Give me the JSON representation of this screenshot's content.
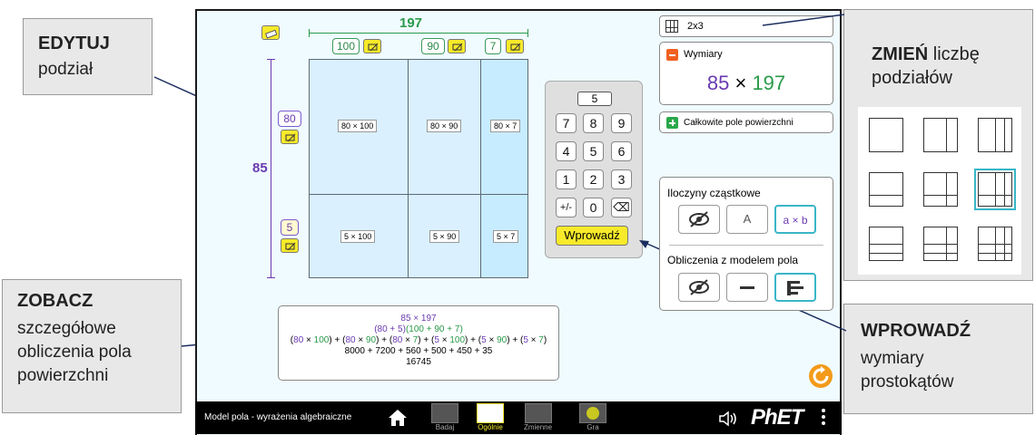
{
  "callouts": {
    "edit": {
      "bold": "EDYTUJ",
      "text": "podział"
    },
    "change": {
      "bold": "ZMIEŃ",
      "text1": "liczbę",
      "text2": "podziałów"
    },
    "view": {
      "bold": "ZOBACZ",
      "lines": [
        "szczegółowe",
        "obliczenia pola",
        "powierzchni"
      ]
    },
    "enter": {
      "bold": "WPROWADŹ",
      "lines": [
        "wymiary",
        "prostokątów"
      ]
    }
  },
  "top_dims": {
    "total": "197",
    "parts": [
      "100",
      "90",
      "7"
    ]
  },
  "left_dims": {
    "total": "85",
    "parts": [
      "80",
      "5"
    ]
  },
  "cells": [
    [
      "80 × 100",
      "80 × 90",
      "80 × 7"
    ],
    [
      "5 × 100",
      "5 × 90",
      "5 × 7"
    ]
  ],
  "keypad": {
    "display": "5",
    "keys": [
      "7",
      "8",
      "9",
      "4",
      "5",
      "6",
      "1",
      "2",
      "3",
      "+/-",
      "0",
      "⌫"
    ],
    "enter_label": "Wprowadź"
  },
  "partition_select": {
    "value": "2x3"
  },
  "dimensions_panel": {
    "title": "Wymiary",
    "left": "85",
    "times": "×",
    "right": "197"
  },
  "total_area": {
    "label": "Całkowite pole powierzchni"
  },
  "partial_products": {
    "title": "Iloczyny cząstkowe",
    "buttons": [
      "",
      "A",
      "a × b"
    ]
  },
  "area_model_calc": {
    "title": "Obliczenia z modelem pola"
  },
  "calculation": {
    "line1": "85 × 197",
    "line2": "(80 + 5)(100 + 90 + 7)",
    "line3_terms": [
      {
        "a": "80",
        "b": "100"
      },
      {
        "a": "80",
        "b": "90"
      },
      {
        "a": "80",
        "b": "7"
      },
      {
        "a": "5",
        "b": "100"
      },
      {
        "a": "5",
        "b": "90"
      },
      {
        "a": "5",
        "b": "7"
      }
    ],
    "line4": "8000 + 7200 + 560 + 500 + 450 + 35",
    "line5": "16745"
  },
  "navbar": {
    "title": "Model pola - wyrażenia algebraiczne",
    "screens": [
      "Badaj",
      "Ogólnie",
      "Zmienne",
      "Gra"
    ],
    "logo": "PhET"
  },
  "colors": {
    "green": "#2a9a4a",
    "purple": "#6a3ab0",
    "yellow": "#f7ea2a",
    "orange": "#f39a1a",
    "accent": "#39b6c8"
  }
}
